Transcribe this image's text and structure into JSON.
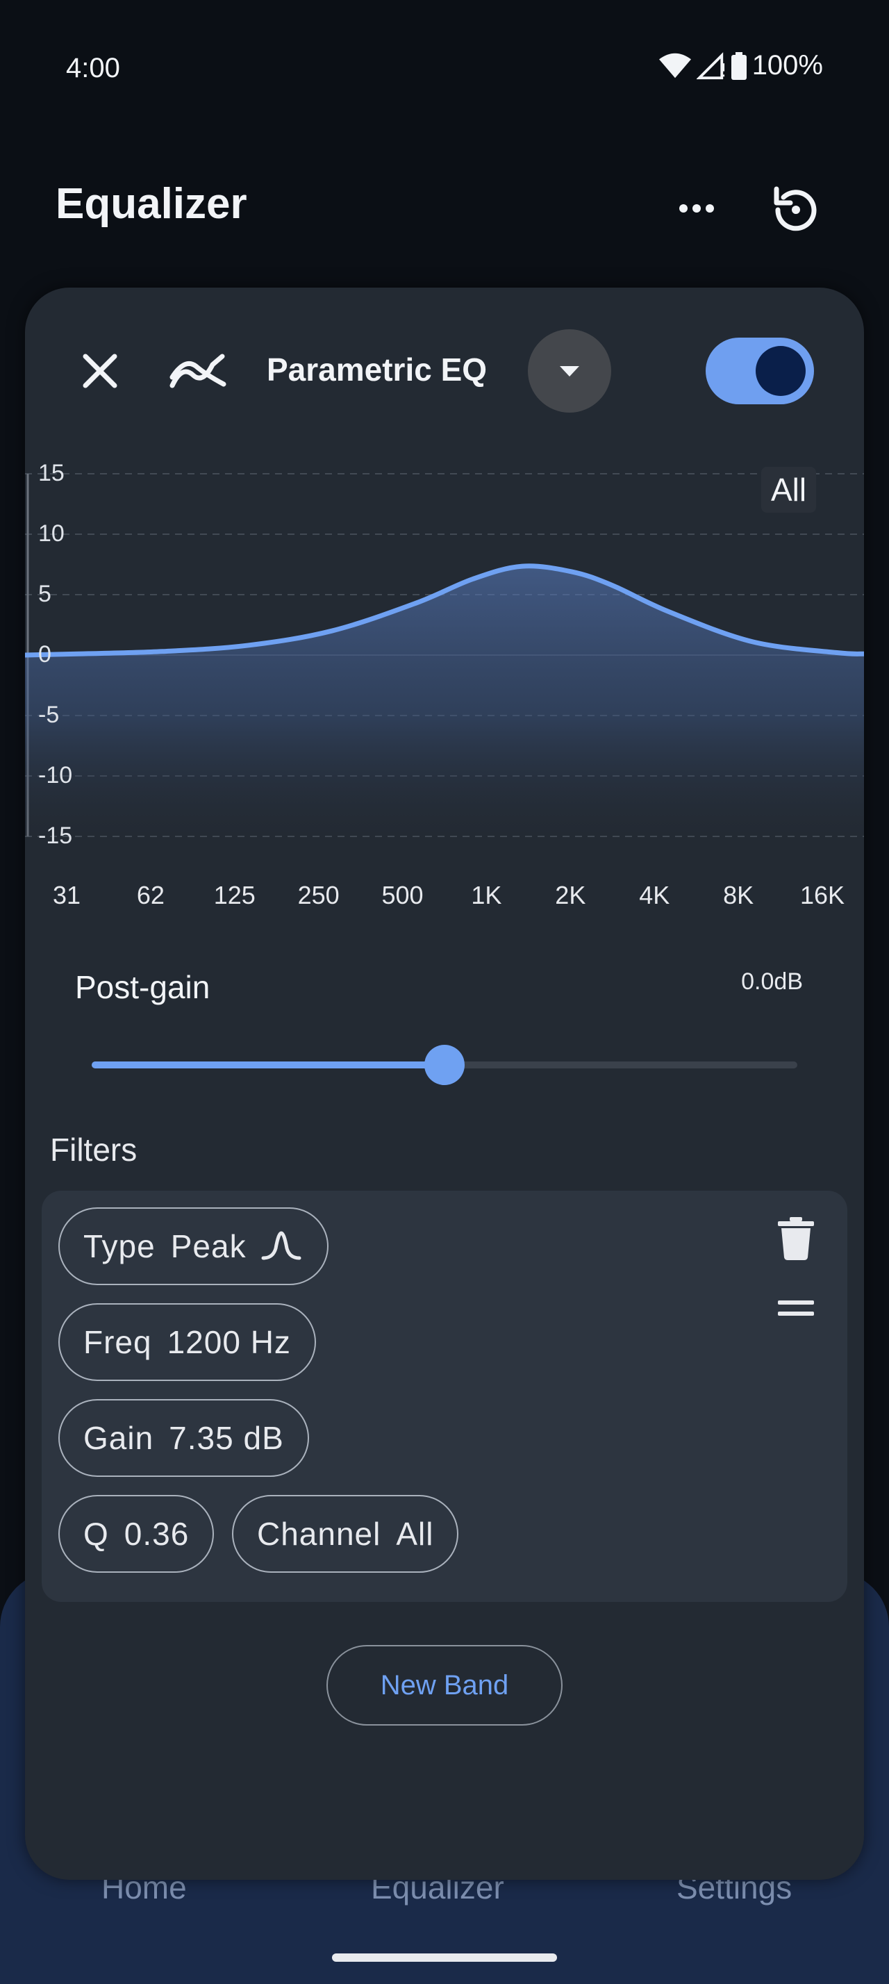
{
  "status_bar": {
    "time": "4:00",
    "battery": "100%"
  },
  "app_bar": {
    "title": "Equalizer"
  },
  "bottom_nav": {
    "items": [
      {
        "label": "Home"
      },
      {
        "label": "Equalizer"
      },
      {
        "label": "Settings"
      }
    ]
  },
  "sheet": {
    "title": "Parametric EQ",
    "enabled": true,
    "channel": "All",
    "chart_data": {
      "type": "line",
      "title": "",
      "xlabel": "",
      "ylabel": "",
      "y_ticks": [
        "15",
        "10",
        "5",
        "0",
        "-5",
        "-10",
        "-15"
      ],
      "x_ticks": [
        "31",
        "62",
        "125",
        "250",
        "500",
        "1K",
        "2K",
        "4K",
        "8K",
        "16K"
      ],
      "ylim": [
        -15,
        15
      ],
      "x_scale": "log",
      "xlim": [
        20,
        20000
      ],
      "grid": true,
      "series": [
        {
          "x": [
            20,
            31,
            62,
            125,
            250,
            500,
            800,
            1200,
            1800,
            2500,
            4000,
            8000,
            16000,
            20000
          ],
          "y": [
            0.0,
            0.1,
            0.3,
            0.8,
            2.0,
            4.3,
            6.3,
            7.35,
            6.9,
            5.8,
            3.6,
            1.1,
            0.2,
            0.1
          ]
        }
      ]
    },
    "post_gain": {
      "label": "Post-gain",
      "value": "0.0dB",
      "level": 0.5
    },
    "filters": {
      "label": "Filters",
      "band": {
        "type_key": "Type",
        "type_value": "Peak",
        "freq_key": "Freq",
        "freq_value": "1200 Hz",
        "gain_key": "Gain",
        "gain_value": "7.35 dB",
        "q_key": "Q",
        "q_value": "0.36",
        "channel_key": "Channel",
        "channel_value": "All"
      }
    },
    "new_band_label": "New Band"
  },
  "colors": {
    "accent": "#6fa1f2",
    "sheet": "#232a33",
    "card": "#2d3540",
    "nav": "#1a2a49"
  }
}
